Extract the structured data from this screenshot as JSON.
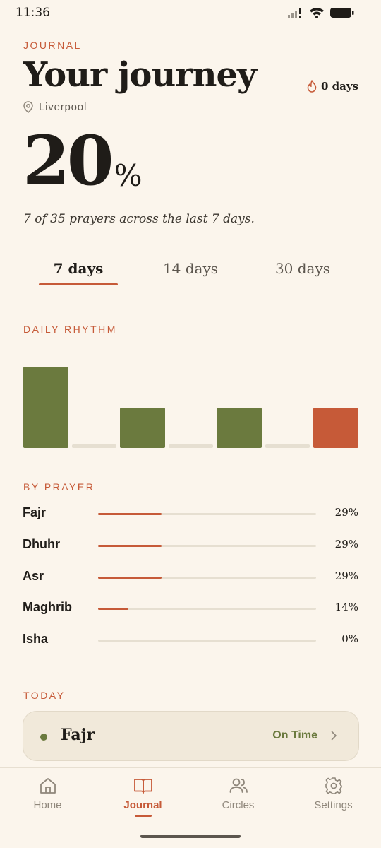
{
  "status": {
    "time": "11:36"
  },
  "header": {
    "eyebrow": "JOURNAL",
    "title": "Your journey",
    "streak_label": "0 days",
    "location": "Liverpool"
  },
  "summary": {
    "percent": "20",
    "percent_unit": "%",
    "caption": "7 of 35 prayers across the last 7 days."
  },
  "tabs": [
    {
      "label": "7 days",
      "active": true
    },
    {
      "label": "14 days",
      "active": false
    },
    {
      "label": "30 days",
      "active": false
    }
  ],
  "daily_rhythm": {
    "heading": "DAILY RHYTHM",
    "days": [
      {
        "count": 2,
        "color": "#6b7a3e"
      },
      {
        "count": 0,
        "color": "#e6dfd1"
      },
      {
        "count": 1,
        "color": "#6b7a3e"
      },
      {
        "count": 0,
        "color": "#e6dfd1"
      },
      {
        "count": 1,
        "color": "#6b7a3e"
      },
      {
        "count": 0,
        "color": "#e6dfd1"
      },
      {
        "count": 1,
        "color": "#c65a38"
      }
    ]
  },
  "by_prayer": {
    "heading": "BY PRAYER",
    "rows": [
      {
        "name": "Fajr",
        "percent_label": "29%",
        "fraction": 0.29
      },
      {
        "name": "Dhuhr",
        "percent_label": "29%",
        "fraction": 0.29
      },
      {
        "name": "Asr",
        "percent_label": "29%",
        "fraction": 0.29
      },
      {
        "name": "Maghrib",
        "percent_label": "14%",
        "fraction": 0.14
      },
      {
        "name": "Isha",
        "percent_label": "0%",
        "fraction": 0
      }
    ]
  },
  "today": {
    "heading": "TODAY",
    "prayer": "Fajr",
    "status": "On Time"
  },
  "nav": [
    {
      "label": "Home",
      "icon": "home-icon",
      "active": false
    },
    {
      "label": "Journal",
      "icon": "book-icon",
      "active": true
    },
    {
      "label": "Circles",
      "icon": "people-icon",
      "active": false
    },
    {
      "label": "Settings",
      "icon": "gear-icon",
      "active": false
    }
  ],
  "colors": {
    "accent": "#c65a38",
    "olive": "#6b7a3e",
    "background": "#fbf5ec"
  }
}
